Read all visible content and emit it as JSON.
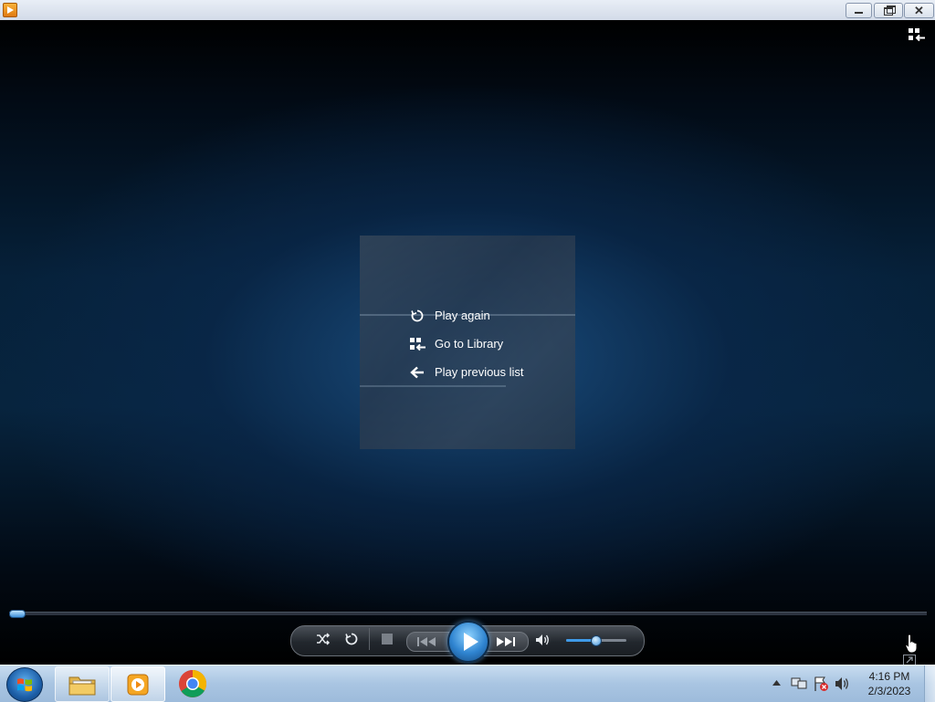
{
  "window": {
    "title": "",
    "buttons": {
      "minimize_icon": "minimize-icon",
      "restore_icon": "restore-icon",
      "close_icon": "close-icon"
    }
  },
  "player": {
    "switch_to_library_icon": "switch-to-library-icon",
    "end_menu": [
      {
        "label": "Play again",
        "icon": "replay-icon"
      },
      {
        "label": "Go to Library",
        "icon": "library-icon"
      },
      {
        "label": "Play previous list",
        "icon": "back-arrow-icon"
      }
    ],
    "seek_position": 0.0,
    "volume_level": 0.5,
    "accent": "#3d8fd8"
  },
  "controls": {
    "shuffle_icon": "shuffle-icon",
    "repeat_icon": "repeat-icon",
    "stop_icon": "stop-icon",
    "previous_icon": "previous-icon",
    "play_icon": "play-icon",
    "next_icon": "next-icon",
    "mute_icon": "speaker-icon",
    "fullscreen_icon": "fullscreen-icon"
  },
  "taskbar": {
    "start_icon": "windows-start-icon",
    "apps": [
      {
        "name": "file-explorer",
        "icon": "folder-icon"
      },
      {
        "name": "windows-media-player",
        "icon": "media-player-icon"
      },
      {
        "name": "google-chrome",
        "icon": "chrome-icon"
      }
    ],
    "tray": {
      "time": "4:16 PM",
      "date": "2/3/2023"
    }
  }
}
